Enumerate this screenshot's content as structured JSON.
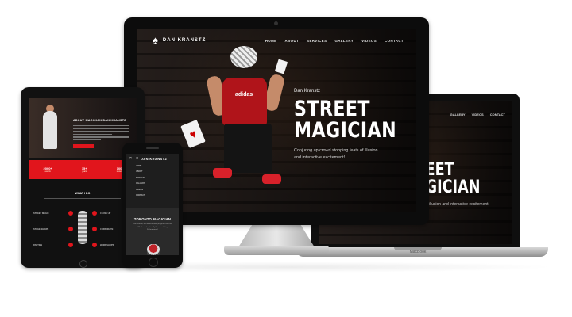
{
  "desktop": {
    "logo_text": "DAN KRANSTZ",
    "nav": [
      "HOME",
      "ABOUT",
      "SERVICES",
      "GALLERY",
      "VIDEOS",
      "CONTACT"
    ],
    "hero_name": "Dan Kranstz",
    "hero_title_line1": "STREET",
    "hero_title_line2": "MAGICIAN",
    "hero_subtitle": "Conjuring up crowd stopping feats of illusion and interactive excitement!",
    "shirt_logo": "adidas"
  },
  "laptop": {
    "nav": [
      "GALLERY",
      "VIDEOS",
      "CONTACT"
    ],
    "hero_title_line1": "REET",
    "hero_title_line2": "AGICIAN",
    "hero_subtitle": "feats of illusion and interactive excitement!",
    "brand": "MacBook"
  },
  "tablet": {
    "about_heading": "ABOUT MAGICIAN DAN KRANSTZ",
    "stats": [
      {
        "value": "2000+",
        "label": "events"
      },
      {
        "value": "15+",
        "label": "years"
      },
      {
        "value": "100",
        "label": "shows"
      }
    ],
    "what_i_do": "WHAT I DO",
    "services": [
      "STREET MAGIC",
      "CLOSE UP",
      "STAGE SHOWS",
      "CORPORATE",
      "PARTIES",
      "WORKSHOPS"
    ]
  },
  "phone": {
    "brand": "DAN KRANSTZ",
    "nav": [
      "HOME",
      "ABOUT",
      "SERVICES",
      "GALLERY",
      "VIDEOS",
      "CONTACT"
    ],
    "title": "TORONTO MAGICIAN",
    "subtitle": "Dan Kranstz, the award winning magician from the GTA. Comedic, Friendly Street and Stage Performances!"
  }
}
